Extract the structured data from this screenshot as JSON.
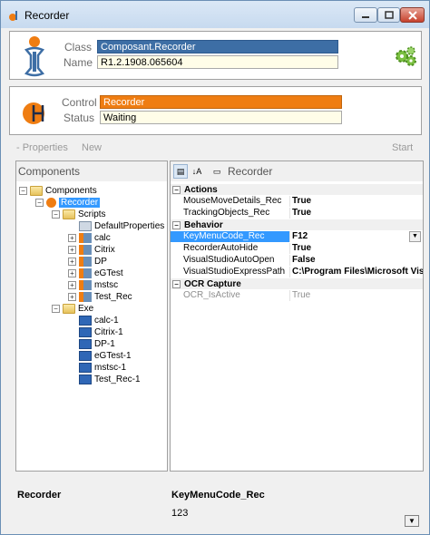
{
  "window": {
    "title": "Recorder"
  },
  "info": {
    "class_label": "Class",
    "class_value": "Composant.Recorder",
    "name_label": "Name",
    "name_value": "R1.2.1908.065604"
  },
  "control": {
    "control_label": "Control",
    "control_value": "Recorder",
    "status_label": "Status",
    "status_value": "Waiting"
  },
  "toolbar": {
    "properties_label": "- Properties",
    "new_label": "New",
    "start_label": "Start"
  },
  "components": {
    "header": "Components",
    "tree": {
      "root": "Components",
      "recorder": "Recorder",
      "scripts": "Scripts",
      "script_items": [
        "DefaultProperties",
        "calc",
        "Citrix",
        "DP",
        "eGTest",
        "mstsc",
        "Test_Rec"
      ],
      "exe": "Exe",
      "exe_items": [
        "calc-1",
        "Citrix-1",
        "DP-1",
        "eGTest-1",
        "mstsc-1",
        "Test_Rec-1"
      ]
    }
  },
  "properties": {
    "header": "Recorder",
    "categories": [
      {
        "name": "Actions",
        "props": [
          {
            "name": "MouseMoveDetails_Rec",
            "value": "True"
          },
          {
            "name": "TrackingObjects_Rec",
            "value": "True"
          }
        ]
      },
      {
        "name": "Behavior",
        "props": [
          {
            "name": "KeyMenuCode_Rec",
            "value": "F12"
          },
          {
            "name": "RecorderAutoHide",
            "value": "True"
          },
          {
            "name": "VisualStudioAutoOpen",
            "value": "False"
          },
          {
            "name": "VisualStudioExpressPath",
            "value": "C:\\Program Files\\Microsoft Visu"
          }
        ]
      },
      {
        "name": "OCR Capture",
        "props": [
          {
            "name": "OCR_IsActive",
            "value": "True"
          }
        ]
      }
    ]
  },
  "footer": {
    "selected_component": "Recorder",
    "selected_property": "KeyMenuCode_Rec",
    "selected_property_value": "123"
  },
  "colors": {
    "class_field_bg": "#3d6ea5",
    "control_field_bg": "#ef7d12",
    "selection": "#3399ff"
  }
}
